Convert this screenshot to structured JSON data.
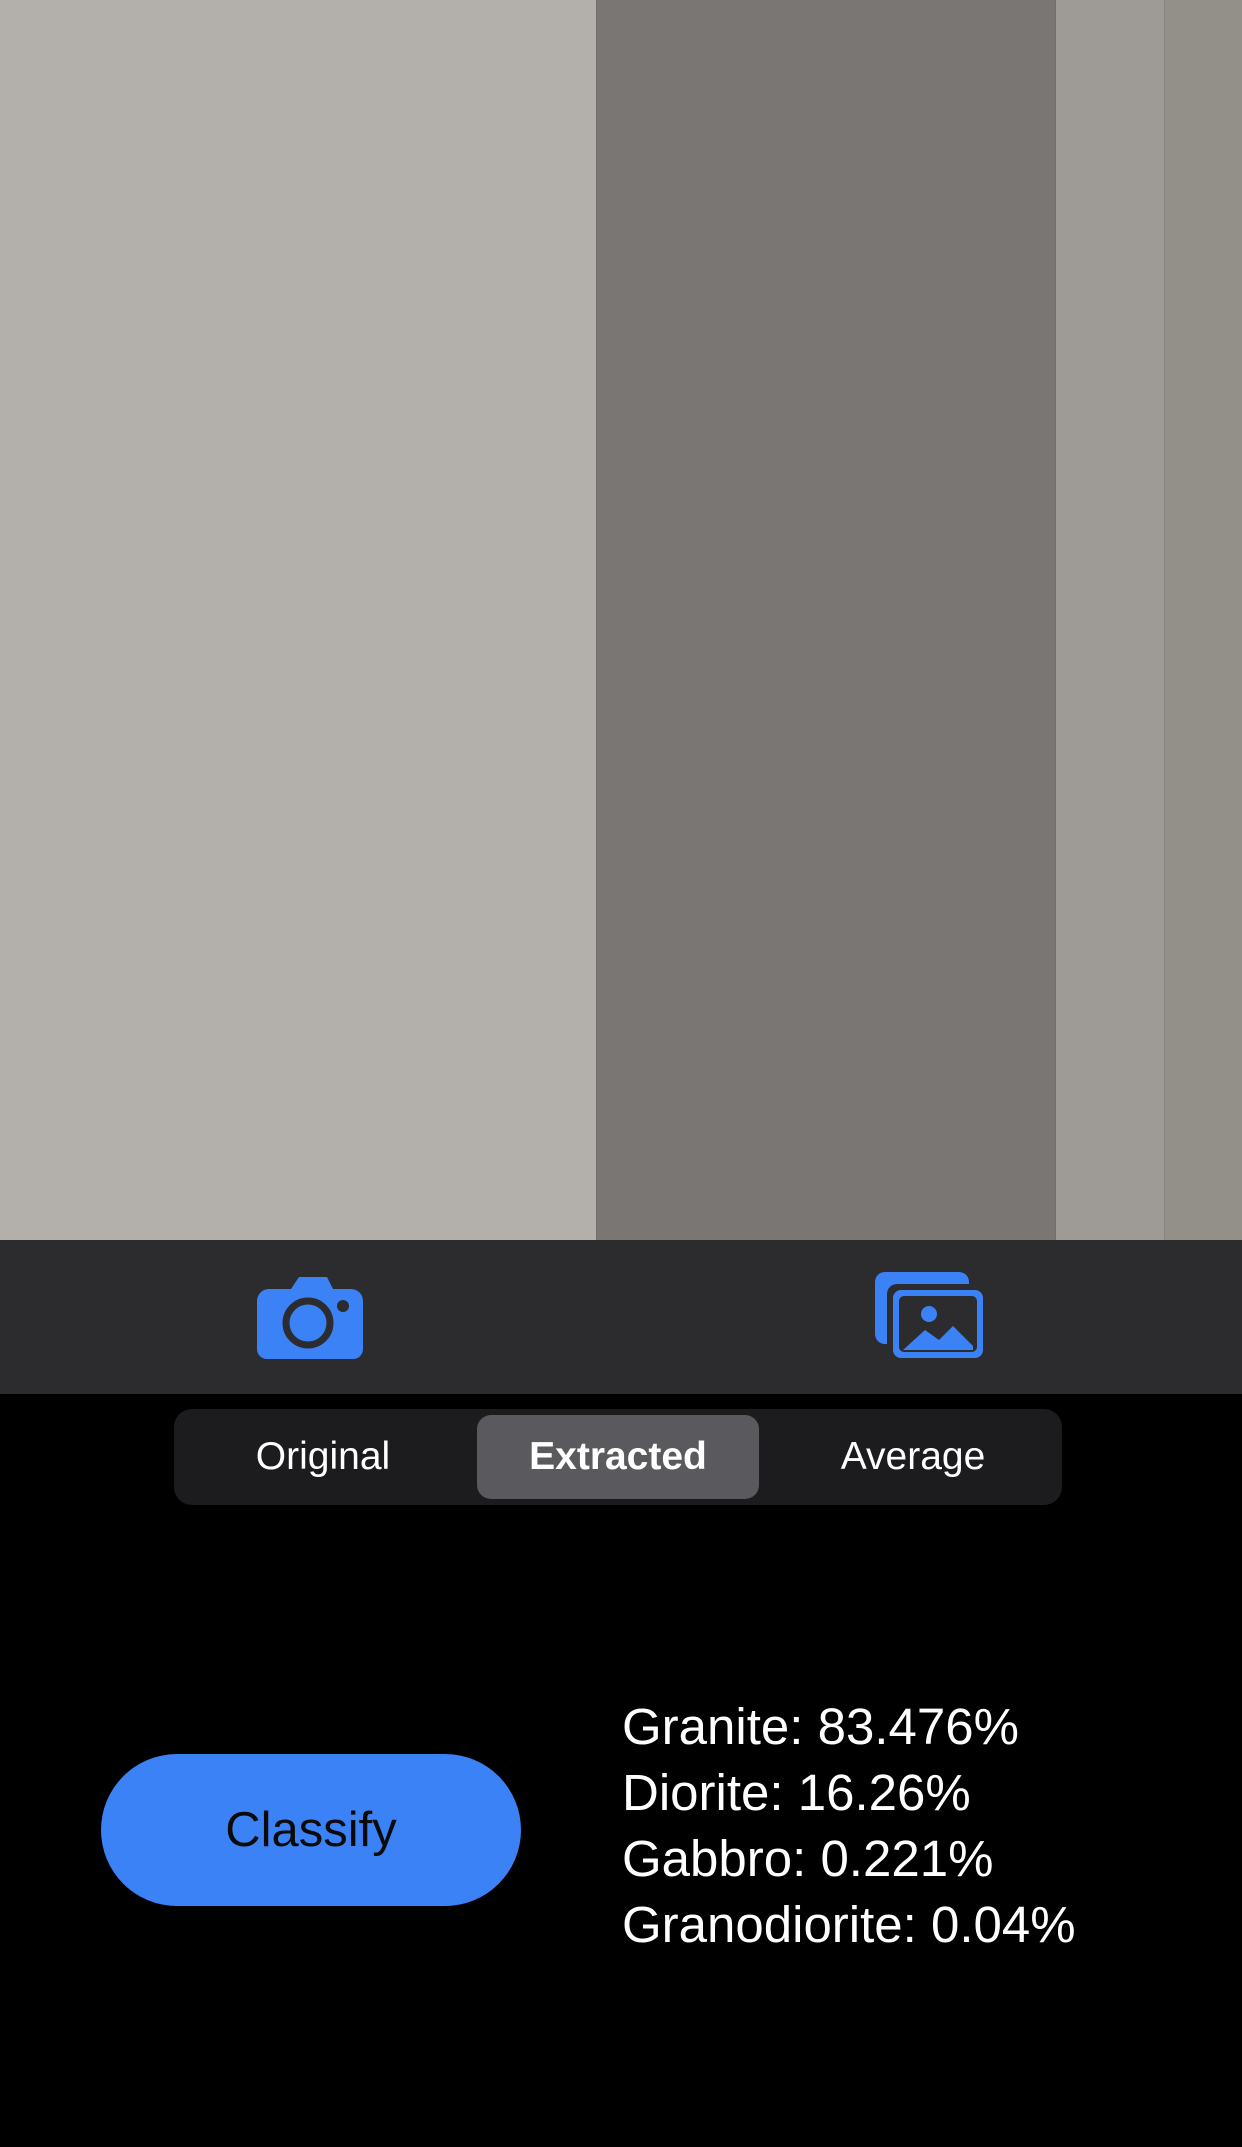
{
  "colors": {
    "accent": "#3b82f6",
    "background": "#000000",
    "toolbar_bg": "#2c2c2e",
    "segment_bg": "#1c1c1e",
    "segment_selected_bg": "#5a5a5e",
    "preview_stripes": [
      "#b3afab",
      "#7a7673",
      "#9e9a96",
      "#93908a"
    ]
  },
  "toolbar": {
    "camera_icon": "camera-icon",
    "photos_icon": "photo-library-icon"
  },
  "segments": {
    "items": [
      {
        "label": "Original"
      },
      {
        "label": "Extracted"
      },
      {
        "label": "Average"
      }
    ],
    "selected": "Extracted"
  },
  "classify_button": {
    "label": "Classify"
  },
  "results": [
    "Granite: 83.476%",
    "Diorite: 16.26%",
    "Gabbro: 0.221%",
    "Granodiorite: 0.04%"
  ]
}
